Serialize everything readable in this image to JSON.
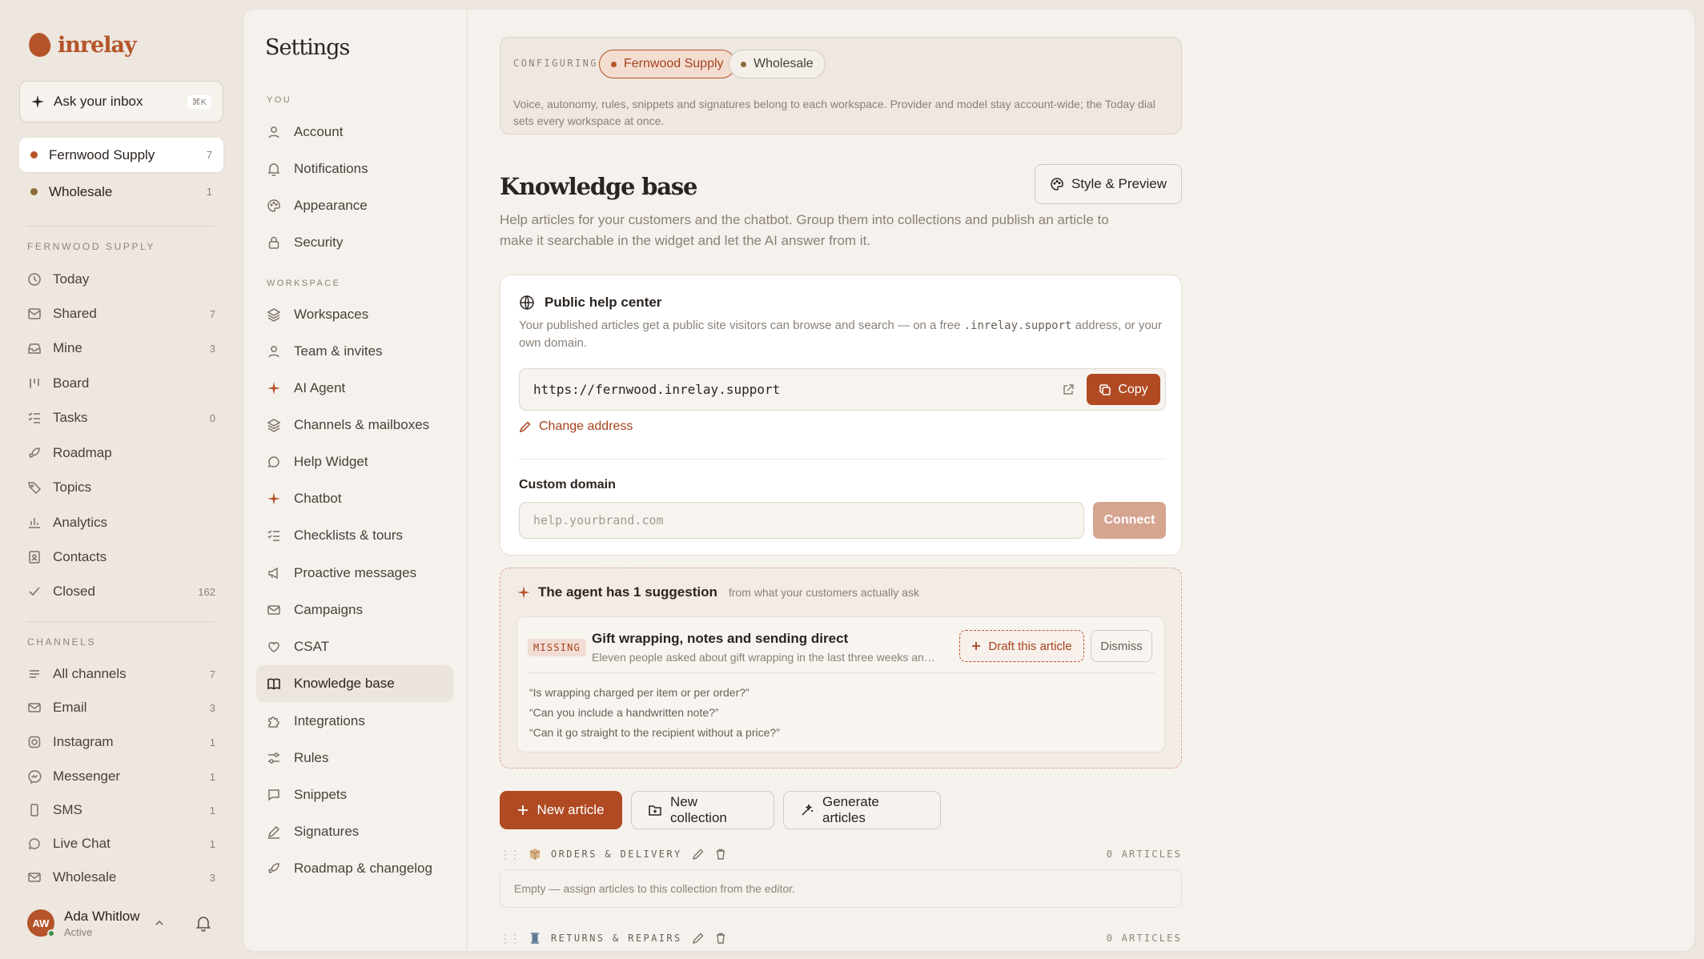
{
  "brand": {
    "name": "inrelay",
    "accent": "#b5542a"
  },
  "ask": {
    "label": "Ask your inbox",
    "shortcut": "⌘K"
  },
  "workspaces": [
    {
      "name": "Fernwood Supply",
      "count": "7",
      "color": "#b5542a",
      "active": true
    },
    {
      "name": "Wholesale",
      "count": "1",
      "color": "#8a6a3a",
      "active": false
    }
  ],
  "sidebar": {
    "section_label": "FERNWOOD SUPPLY",
    "items": [
      {
        "label": "Today",
        "count": "",
        "icon": "clock-icon"
      },
      {
        "label": "Shared",
        "count": "7",
        "icon": "inbox-icon"
      },
      {
        "label": "Mine",
        "count": "3",
        "icon": "tray-icon"
      },
      {
        "label": "Board",
        "count": "",
        "icon": "board-icon"
      },
      {
        "label": "Tasks",
        "count": "0",
        "icon": "tasks-icon"
      },
      {
        "label": "Roadmap",
        "count": "",
        "icon": "rocket-icon"
      },
      {
        "label": "Topics",
        "count": "",
        "icon": "tag-icon"
      },
      {
        "label": "Analytics",
        "count": "",
        "icon": "bar-chart-icon"
      },
      {
        "label": "Contacts",
        "count": "",
        "icon": "contacts-icon"
      },
      {
        "label": "Closed",
        "count": "162",
        "icon": "check-icon"
      }
    ],
    "channels_label": "CHANNELS",
    "channels": [
      {
        "label": "All channels",
        "count": "7",
        "icon": "lines-icon"
      },
      {
        "label": "Email",
        "count": "3",
        "icon": "mail-icon"
      },
      {
        "label": "Instagram",
        "count": "1",
        "icon": "instagram-icon"
      },
      {
        "label": "Messenger",
        "count": "1",
        "icon": "messenger-icon"
      },
      {
        "label": "SMS",
        "count": "1",
        "icon": "phone-icon"
      },
      {
        "label": "Live Chat",
        "count": "1",
        "icon": "chat-icon"
      },
      {
        "label": "Wholesale",
        "count": "3",
        "icon": "mail-icon"
      }
    ]
  },
  "user": {
    "initials": "AW",
    "name": "Ada Whitlow",
    "status": "Active"
  },
  "settings": {
    "title": "Settings",
    "you_label": "YOU",
    "you_items": [
      {
        "label": "Account",
        "icon": "user-icon"
      },
      {
        "label": "Notifications",
        "icon": "bell-icon"
      },
      {
        "label": "Appearance",
        "icon": "palette-icon"
      },
      {
        "label": "Security",
        "icon": "lock-icon"
      }
    ],
    "workspace_label": "WORKSPACE",
    "workspace_items": [
      {
        "label": "Workspaces",
        "icon": "layers-icon"
      },
      {
        "label": "Team & invites",
        "icon": "user-icon"
      },
      {
        "label": "AI Agent",
        "icon": "sparkle-icon"
      },
      {
        "label": "Channels & mailboxes",
        "icon": "layers-icon"
      },
      {
        "label": "Help Widget",
        "icon": "chat-icon"
      },
      {
        "label": "Chatbot",
        "icon": "sparkle-icon"
      },
      {
        "label": "Checklists & tours",
        "icon": "checklist-icon"
      },
      {
        "label": "Proactive messages",
        "icon": "megaphone-icon"
      },
      {
        "label": "Campaigns",
        "icon": "mail-icon"
      },
      {
        "label": "CSAT",
        "icon": "heart-icon"
      },
      {
        "label": "Knowledge base",
        "icon": "book-icon",
        "active": true
      },
      {
        "label": "Integrations",
        "icon": "puzzle-icon"
      },
      {
        "label": "Rules",
        "icon": "sliders-icon"
      },
      {
        "label": "Snippets",
        "icon": "message-square-icon"
      },
      {
        "label": "Signatures",
        "icon": "pen-icon"
      },
      {
        "label": "Roadmap & changelog",
        "icon": "rocket-icon"
      }
    ]
  },
  "configuring": {
    "label": "CONFIGURING",
    "active_chip": "Fernwood Supply",
    "inactive_chip": "Wholesale",
    "description": "Voice, autonomy, rules, snippets and signatures belong to each workspace. Provider and model stay account-wide; the Today dial sets every workspace at once."
  },
  "knowledge_base": {
    "title": "Knowledge base",
    "style_button": "Style & Preview",
    "description": "Help articles for your customers and the chatbot. Group them into collections and publish an article to make it searchable in the widget and let the AI answer from it."
  },
  "help_center": {
    "title": "Public help center",
    "desc_before": "Your published articles get a public site visitors can browse and search — on a free ",
    "desc_code": ".inrelay.support",
    "desc_after": " address, or your own domain.",
    "url": "https://fernwood.inrelay.support",
    "copy_label": "Copy",
    "change_label": "Change address",
    "custom_domain_label": "Custom domain",
    "custom_domain_placeholder": "help.yourbrand.com",
    "connect_label": "Connect"
  },
  "suggestion": {
    "heading": "The agent has 1 suggestion",
    "subheading": "from what your customers actually ask",
    "badge": "MISSING",
    "title": "Gift wrapping, notes and sending direct",
    "excerpt": "Eleven people asked about gift wrapping in the last three weeks an…",
    "draft_label": "Draft this article",
    "dismiss_label": "Dismiss",
    "quotes": [
      "“Is wrapping charged per item or per order?”",
      "“Can you include a handwritten note?”",
      "“Can it go straight to the recipient without a price?”"
    ]
  },
  "actions": {
    "new_article": "New article",
    "new_collection": "New collection",
    "generate_articles": "Generate articles"
  },
  "collections": [
    {
      "name": "ORDERS & DELIVERY",
      "count": "0 ARTICLES",
      "empty_text": "Empty — assign articles to this collection from the editor."
    },
    {
      "name": "RETURNS & REPAIRS",
      "count": "0 ARTICLES"
    }
  ]
}
